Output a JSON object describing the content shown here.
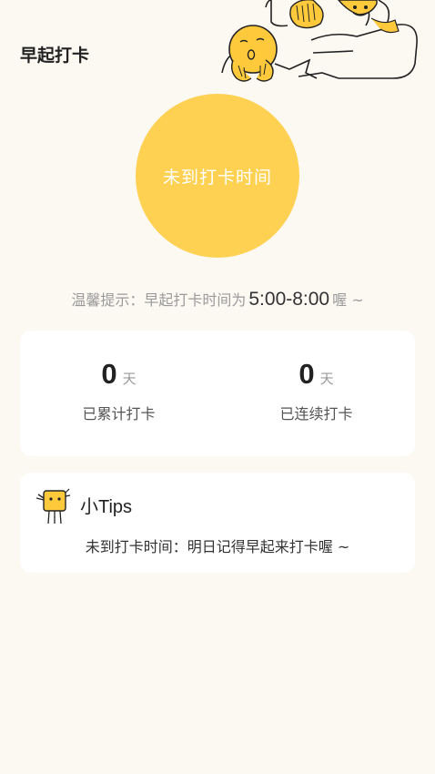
{
  "header": {
    "title": "早起打卡"
  },
  "checkin": {
    "button_label": "未到打卡时间"
  },
  "hint": {
    "prefix": "温馨提示：早起打卡时间为",
    "time_range": "5:00-8:00",
    "suffix": "喔 ~"
  },
  "stats": [
    {
      "value": "0",
      "unit": "天",
      "label": "已累计打卡"
    },
    {
      "value": "0",
      "unit": "天",
      "label": "已连续打卡"
    }
  ],
  "tips": {
    "title": "小Tips",
    "text": "未到打卡时间：明日记得早起来打卡喔 ~"
  },
  "colors": {
    "background": "#FCF9F3",
    "accent": "#FFD152",
    "card": "#FFFFFF"
  }
}
